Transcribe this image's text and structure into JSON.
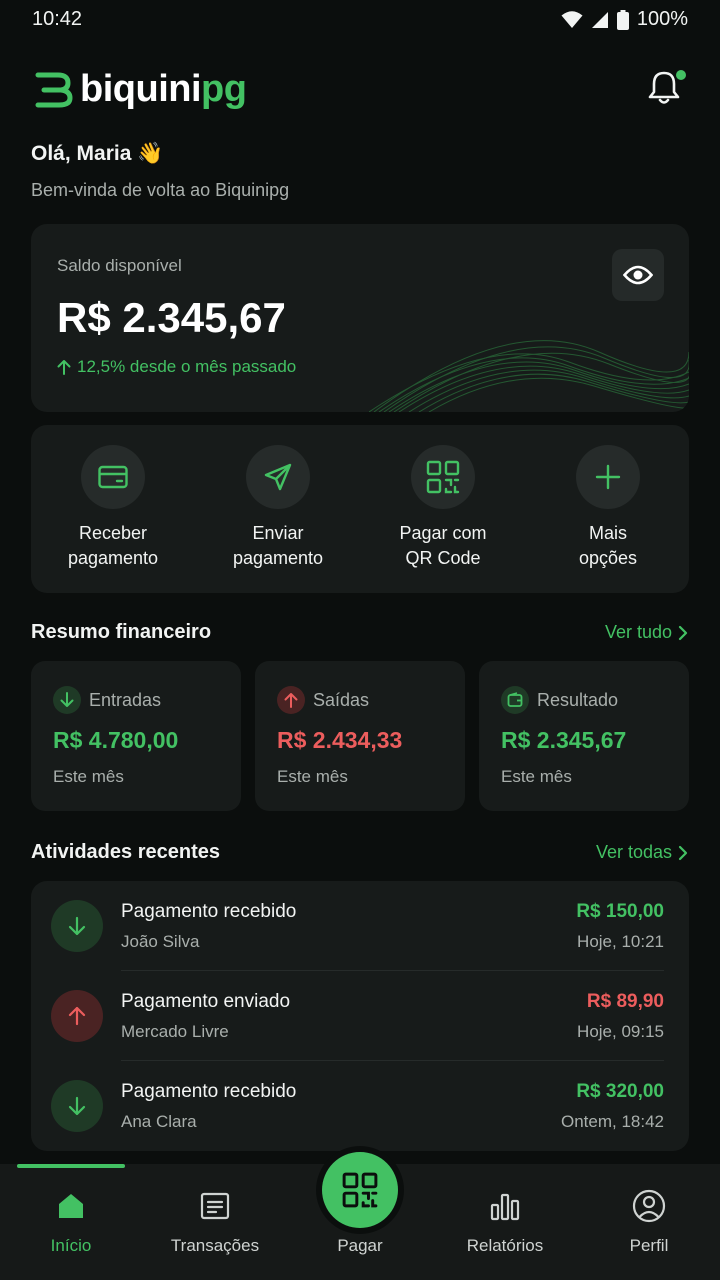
{
  "status_bar": {
    "time": "10:42",
    "battery": "100%"
  },
  "header": {
    "logo_part1": "biquini",
    "logo_part2": "pg",
    "notifications_icon": "bell-icon"
  },
  "greeting": {
    "title": "Olá, Maria 👋",
    "subtitle": "Bem-vinda de volta ao Biquinipg"
  },
  "balance": {
    "label": "Saldo disponível",
    "value": "R$ 2.345,67",
    "change": "12,5% desde o mês passado",
    "toggle_icon": "eye-icon"
  },
  "quick_actions": [
    {
      "line1": "Receber",
      "line2": "pagamento",
      "icon": "card-icon"
    },
    {
      "line1": "Enviar",
      "line2": "pagamento",
      "icon": "send-icon"
    },
    {
      "line1": "Pagar com",
      "line2": "QR Code",
      "icon": "qr-code-icon"
    },
    {
      "line1": "Mais",
      "line2": "opções",
      "icon": "plus-icon"
    }
  ],
  "summary": {
    "title": "Resumo financeiro",
    "link": "Ver tudo",
    "cards": [
      {
        "label": "Entradas",
        "value": "R$ 4.780,00",
        "note": "Este mês",
        "color": "#43c163"
      },
      {
        "label": "Saídas",
        "value": "R$ 2.434,33",
        "note": "Este mês",
        "color": "#ec5d5d"
      },
      {
        "label": "Resultado",
        "value": "R$ 2.345,67",
        "note": "Este mês",
        "color": "#43c163"
      }
    ]
  },
  "activities": {
    "title": "Atividades recentes",
    "link": "Ver todas",
    "items": [
      {
        "title": "Pagamento recebido",
        "party": "João Silva",
        "amount": "R$ 150,00",
        "time": "Hoje, 10:21",
        "direction": "in"
      },
      {
        "title": "Pagamento enviado",
        "party": "Mercado Livre",
        "amount": "R$ 89,90",
        "time": "Hoje, 09:15",
        "direction": "out"
      },
      {
        "title": "Pagamento recebido",
        "party": "Ana Clara",
        "amount": "R$ 320,00",
        "time": "Ontem, 18:42",
        "direction": "in"
      }
    ]
  },
  "nav": {
    "items": [
      "Início",
      "Transações",
      "Pagar",
      "Relatórios",
      "Perfil"
    ],
    "active": "Início"
  },
  "colors": {
    "accent": "#43c163",
    "negative": "#ec5d5d",
    "background": "#0b0e0d",
    "card": "#171b1a"
  }
}
